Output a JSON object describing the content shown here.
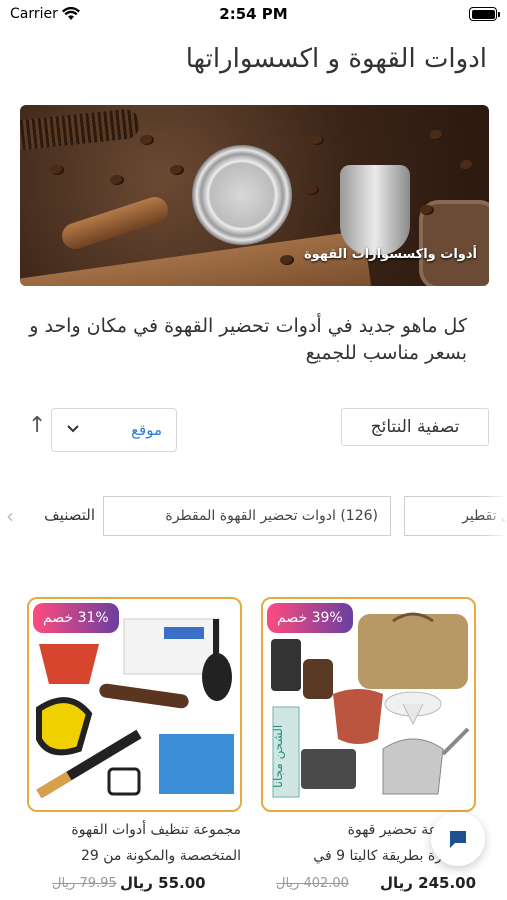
{
  "status_bar": {
    "carrier": "Carrier",
    "time": "2:54 PM"
  },
  "page": {
    "title": "ادوات القهوة و اكسسواراتها"
  },
  "banner": {
    "caption": "أدوات واكسسوارات القهوة"
  },
  "tagline": "كل ماهو جديد في أدوات تحضير القهوة في مكان واحد و بسعر مناسب للجميع",
  "toolbar": {
    "sort_value": "موقع",
    "filter_label": "تصفية النتائج"
  },
  "categories": {
    "label": "التصنيف",
    "chips": [
      {
        "text": "(126)  ادوات تحضير القهوة المقطرة"
      },
      {
        "text": "ى تقطير"
      }
    ]
  },
  "products": [
    {
      "badge": "39% خصم",
      "title_line1": "مجموعة تحضير قهوة",
      "title_line2": "مقطرة بطريقة كاليتا 9 في",
      "price": "245.00 ريال",
      "old_price": "402.00 ريال",
      "ribbon": "الشحن مجانا"
    },
    {
      "badge": "31% خصم",
      "title_line1": "مجموعة تنظيف أدوات القهوة",
      "title_line2": "المتخصصة والمكونة من 29",
      "price": "55.00 ريال",
      "old_price": "79.95 ريال"
    }
  ],
  "colors": {
    "accent": "#2a7de1",
    "card_border": "#e8a93f",
    "badge_start": "#ff4b7d",
    "badge_end": "#6a3fa0"
  }
}
